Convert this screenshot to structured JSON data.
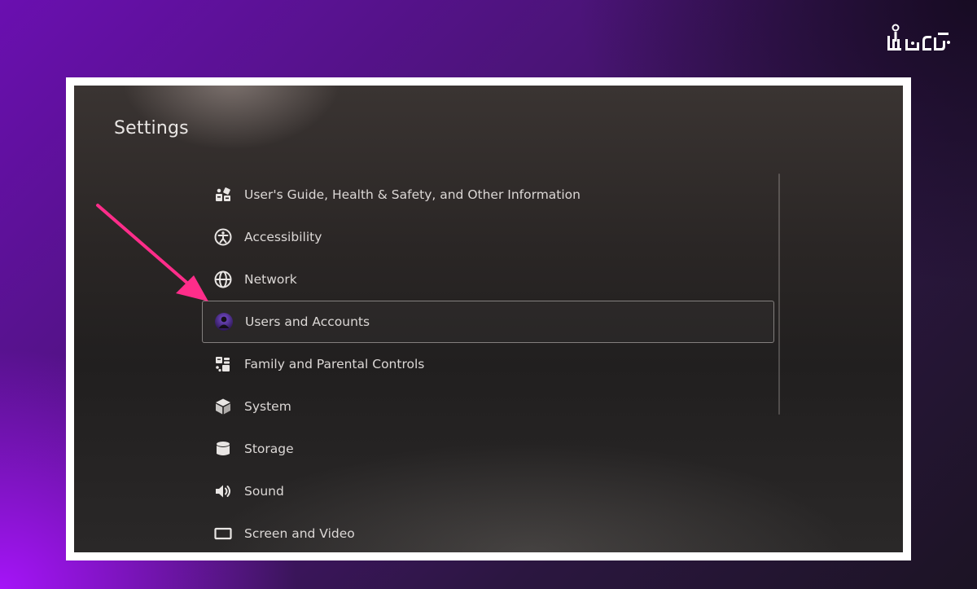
{
  "watermark": {
    "text": "آکتر باز",
    "icon": "brand-logo"
  },
  "screen": {
    "title": "Settings"
  },
  "settings_menu": {
    "items": [
      {
        "label": "User's Guide, Health & Safety, and Other Information",
        "icon": "guide-icon",
        "selected": false
      },
      {
        "label": "Accessibility",
        "icon": "accessibility-icon",
        "selected": false
      },
      {
        "label": "Network",
        "icon": "globe-icon",
        "selected": false
      },
      {
        "label": "Users and Accounts",
        "icon": "user-avatar-icon",
        "selected": true
      },
      {
        "label": "Family and Parental Controls",
        "icon": "family-controls-icon",
        "selected": false
      },
      {
        "label": "System",
        "icon": "cube-icon",
        "selected": false
      },
      {
        "label": "Storage",
        "icon": "storage-icon",
        "selected": false
      },
      {
        "label": "Sound",
        "icon": "speaker-icon",
        "selected": false
      },
      {
        "label": "Screen and Video",
        "icon": "screen-icon",
        "selected": false
      }
    ]
  },
  "annotation": {
    "arrow_color": "#ff2d8a",
    "points_to": "Users and Accounts"
  },
  "colors": {
    "background_accent": "#8a12e0",
    "frame_border": "#ffffff",
    "text": "#dcd8d6"
  }
}
